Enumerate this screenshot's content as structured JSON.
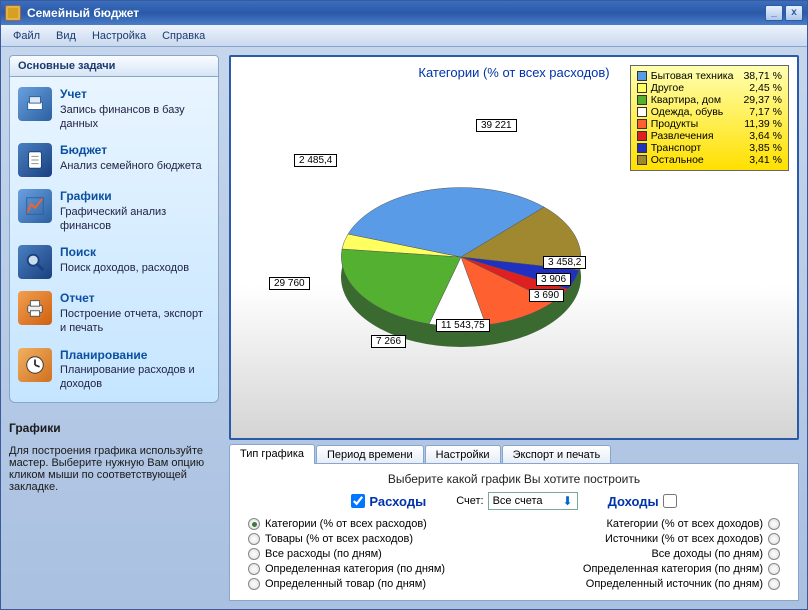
{
  "window": {
    "title": "Семейный бюджет",
    "min_btn": "_",
    "close_btn": "x"
  },
  "menu": [
    "Файл",
    "Вид",
    "Настройка",
    "Справка"
  ],
  "sidebar": {
    "header": "Основные задачи",
    "tasks": [
      {
        "title": "Учет",
        "desc": "Запись финансов в базу данных",
        "color": "#4a7ac8"
      },
      {
        "title": "Бюджет",
        "desc": "Анализ семейного бюджета",
        "color": "#2a5fa8"
      },
      {
        "title": "Графики",
        "desc": "Графический анализ финансов",
        "color": "#5a8acc"
      },
      {
        "title": "Поиск",
        "desc": "Поиск доходов, расходов",
        "color": "#3a6eb8"
      },
      {
        "title": "Отчет",
        "desc": "Построение отчета, экспорт и печать",
        "color": "#e07020"
      },
      {
        "title": "Планирование",
        "desc": "Планирование расходов и доходов",
        "color": "#e09020"
      }
    ],
    "help": {
      "title": "Графики",
      "text": "Для построения графика используйте мастер. Выберите нужную Вам опцию кликом мыши по соответствующей закладке."
    }
  },
  "chart_data": {
    "type": "pie",
    "title": "Категории (% от всех расходов)",
    "series": [
      {
        "name": "Бытовая техника",
        "percent": 38.71,
        "value": 39221,
        "color": "#5a9be8"
      },
      {
        "name": "Другое",
        "percent": 2.45,
        "value": 2485.4,
        "color": "#ffff60"
      },
      {
        "name": "Квартира, дом",
        "percent": 29.37,
        "value": 29760,
        "color": "#53b030"
      },
      {
        "name": "Одежда, обувь",
        "percent": 7.17,
        "value": 7266,
        "color": "#ffffff"
      },
      {
        "name": "Продукты",
        "percent": 11.39,
        "value": 11543.75,
        "color": "#ff6030"
      },
      {
        "name": "Развлечения",
        "percent": 3.64,
        "value": 3690,
        "color": "#e02020"
      },
      {
        "name": "Транспорт",
        "percent": 3.85,
        "value": 3906,
        "color": "#2030c0"
      },
      {
        "name": "Остальное",
        "percent": 3.41,
        "value": 3458.2,
        "color": "#a08830"
      }
    ],
    "labels": {
      "0": "39 221",
      "1": "2 485,4",
      "2": "29 760",
      "3": "7 266",
      "4": "11 543,75",
      "5": "3 690",
      "6": "3 906",
      "7": "3 458,2"
    }
  },
  "bottom": {
    "tabs": [
      "Тип графика",
      "Период времени",
      "Настройки",
      "Экспорт и печать"
    ],
    "prompt": "Выберите какой график Вы хотите построить",
    "expenses_label": "Расходы",
    "account_label": "Счет:",
    "account_value": "Все счета",
    "income_label": "Доходы",
    "left_opts": [
      "Категории (% от всех расходов)",
      "Товары (% от всех расходов)",
      "Все расходы (по дням)",
      "Определенная категория (по дням)",
      "Определенный товар (по дням)"
    ],
    "right_opts": [
      "Категории (% от всех доходов)",
      "Источники (% от всех доходов)",
      "Все доходы (по дням)",
      "Определенная категория (по дням)",
      "Определенный источник (по дням)"
    ]
  }
}
